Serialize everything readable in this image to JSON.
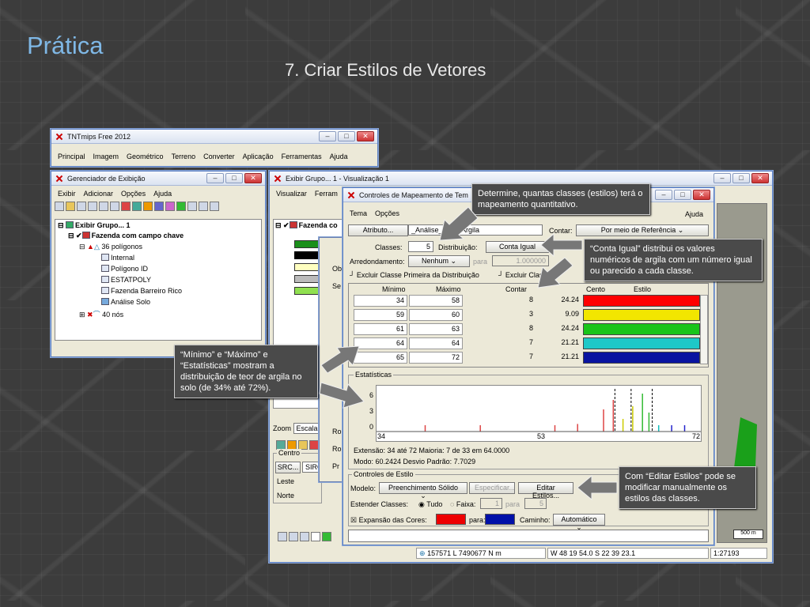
{
  "slide": {
    "title": "Prática",
    "subtitle": "7. Criar Estilos de Vetores"
  },
  "tntmips": {
    "title": "TNTmips Free 2012",
    "menu": [
      "Principal",
      "Imagem",
      "Geométrico",
      "Terreno",
      "Converter",
      "Aplicação",
      "Ferramentas",
      "Ajuda"
    ]
  },
  "gerenciador": {
    "title": "Gerenciador de Exibição",
    "menu": [
      "Exibir",
      "Adicionar",
      "Opções",
      "Ajuda"
    ],
    "tree": {
      "group": "Exibir Grupo... 1",
      "layer": "Fazenda com campo chave",
      "polygons": "36 polígonos",
      "items": [
        "Internal",
        "Polígono ID",
        "ESTATPOLY",
        "Fazenda Barreiro Rico",
        "Análise Solo"
      ],
      "nodes": "40 nós"
    }
  },
  "visualizacao": {
    "title": "Exibir Grupo... 1 - Visualização 1",
    "menu": [
      "Visualizar",
      "Ferram"
    ],
    "layer": "Fazenda co",
    "zoom_label": "Zoom",
    "escala_label": "Escala",
    "centro_label": "Centro",
    "src_label": "SRC...",
    "sirg_label": "SIRG",
    "leste_label": "Leste",
    "norte_label": "Norte",
    "obs_frag": "Ob",
    "se_frag": "Se",
    "ro1_frag": "Ro",
    "ro2_frag": "Ro",
    "pr_frag": "Pr",
    "scale_bar": "500 m",
    "status": {
      "coords": "157571 L  7490677 N m",
      "latlon": "W 48 19 54.0  S 22 39 23.1",
      "scale": "1:27193"
    }
  },
  "controles": {
    "title": "Controles de Mapeamento de Tem",
    "menu": [
      "Tema",
      "Opções"
    ],
    "help": "Ajuda",
    "atributo_btn": "Atributo...",
    "atributo_value": "_Análise_So..o.Argila",
    "contar_label": "Contar:",
    "contar_value": "Por meio de Referência",
    "classes_label": "Classes:",
    "classes_value": "5",
    "distribuicao_label": "Distribuição:",
    "distribuicao_value": "Conta Igual",
    "arredondamento_label": "Arredondamento:",
    "arredondamento_value": "Nenhum",
    "para_label": "para",
    "para_value": "1.000000",
    "excluir_primeira": "Excluir Classe Primeira da Distribuição",
    "excluir_ultima": "Excluir Classe",
    "table_headers": {
      "min": "Mínimo",
      "max": "Máximo",
      "count": "Contar",
      "pct": "Cento",
      "style": "Estilo"
    },
    "rows": [
      {
        "min": "34",
        "max": "58",
        "count": "8",
        "pct": "24.24",
        "color": "#ff0000"
      },
      {
        "min": "59",
        "max": "60",
        "count": "3",
        "pct": "9.09",
        "color": "#f2e600"
      },
      {
        "min": "61",
        "max": "63",
        "count": "8",
        "pct": "24.24",
        "color": "#19c419"
      },
      {
        "min": "64",
        "max": "64",
        "count": "7",
        "pct": "21.21",
        "color": "#1ec8c8"
      },
      {
        "min": "65",
        "max": "72",
        "count": "7",
        "pct": "21.21",
        "color": "#0a14a0"
      }
    ],
    "estatisticas_label": "Estatísticas",
    "y_ticks": [
      "6",
      "3",
      "0"
    ],
    "x_ticks": [
      "34",
      "53",
      "72"
    ],
    "extensao": "Extensão: 34 até 72  Maioria: 7 de 33 em 64.0000",
    "modo": "Modo: 60.2424  Desvio Padrão: 7.7029",
    "estilo_label": "Controles de Estilo",
    "modelo_label": "Modelo:",
    "modelo_value": "Preenchimento Sólido",
    "especificar_btn": "Especificar...",
    "editar_btn": "Editar Estilos...",
    "estender_label": "Estender Classes:",
    "tudo_label": "Tudo",
    "faixa_label": "Faixa:",
    "faixa_from": "1",
    "faixa_para": "para",
    "faixa_to": "5",
    "expansao_label": "Expansão das Cores:",
    "expansao_para": "para:",
    "caminho_label": "Caminho:",
    "caminho_value": "Automático",
    "color_from": "#ee0000",
    "color_to": "#0010a8"
  },
  "callouts": {
    "classes": "Determine, quantas classes (estilos) terá o mapeamento quantitativo.",
    "conta": "“Conta Igual” distribui os valores numéricos de argila com um número igual ou parecido a cada classe.",
    "minmax": "“Mínimo” e “Máximo” e “Estatísticas” mostram a distribuição de teor de argila no solo (de 34% até 72%).",
    "editar": "Com “Editar Estilos” pode se modificar manualmente os estilos das classes."
  }
}
